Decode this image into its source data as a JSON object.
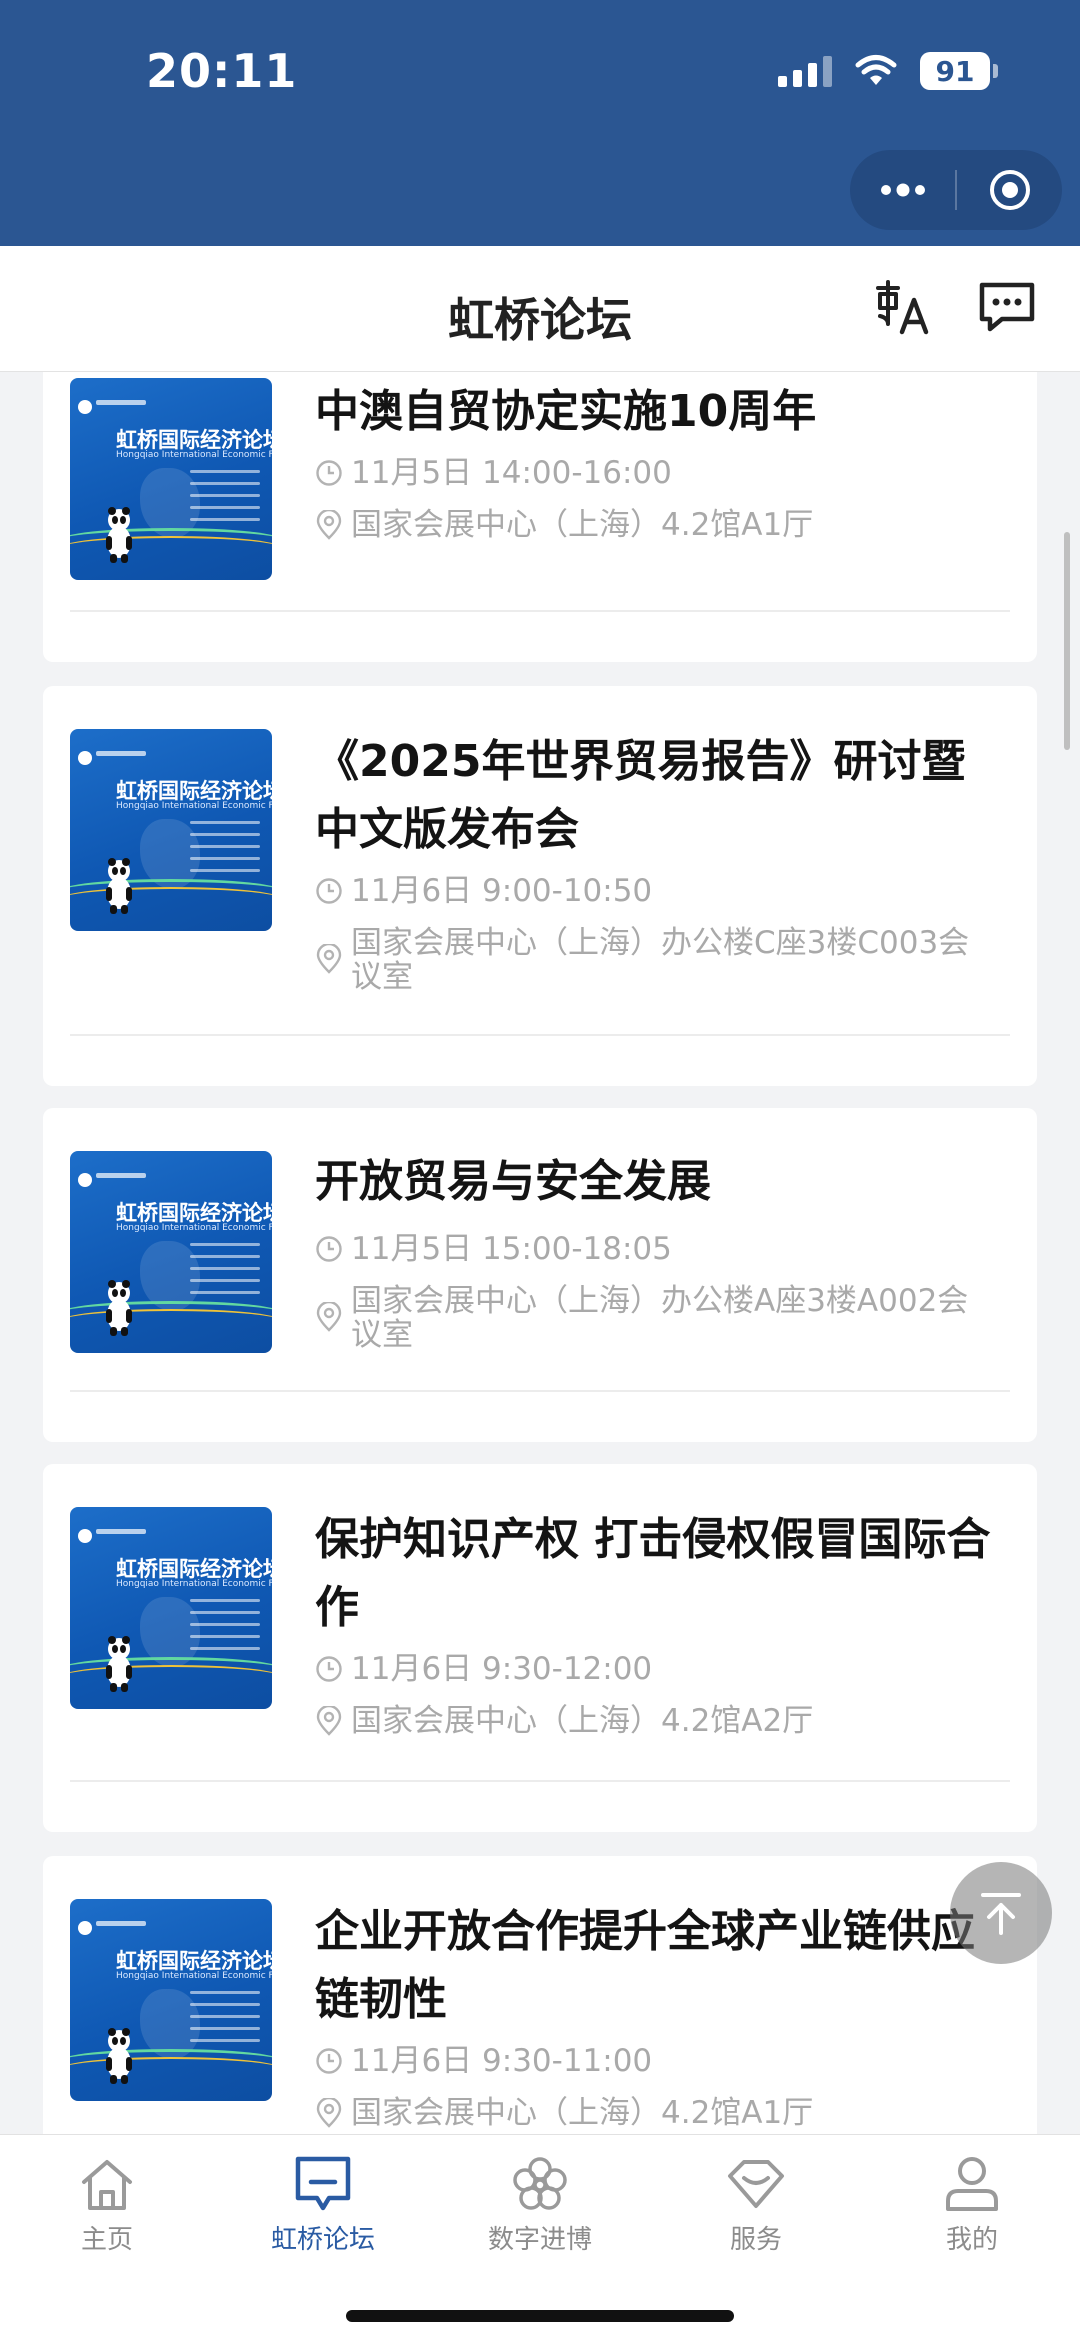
{
  "status_bar": {
    "time": "20:11",
    "battery": "91"
  },
  "header": {
    "title": "虹桥论坛"
  },
  "thumbnail": {
    "title": "虹桥国际经济论坛会",
    "subtitle": "Hongqiao International Economic Forum"
  },
  "events": [
    {
      "title": "中澳自贸协定实施10周年",
      "time": "11月5日 14:00-16:00",
      "location": "国家会展中心（上海）4.2馆A1厅"
    },
    {
      "title": "《2025年世界贸易报告》研讨暨中文版发布会",
      "time": "11月6日 9:00-10:50",
      "location": "国家会展中心（上海）办公楼C座3楼C003会议室"
    },
    {
      "title": "开放贸易与安全发展",
      "time": "11月5日 15:00-18:05",
      "location": "国家会展中心（上海）办公楼A座3楼A002会议室"
    },
    {
      "title": "保护知识产权 打击侵权假冒国际合作",
      "time": "11月6日 9:30-12:00",
      "location": "国家会展中心（上海）4.2馆A2厅"
    },
    {
      "title": "企业开放合作提升全球产业链供应链韧性",
      "time": "11月6日 9:30-11:00",
      "location": "国家会展中心（上海）4.2馆A1厅"
    }
  ],
  "tabs": [
    {
      "label": "主页",
      "icon": "home-icon"
    },
    {
      "label": "虹桥论坛",
      "icon": "forum-icon"
    },
    {
      "label": "数字进博",
      "icon": "flower-icon"
    },
    {
      "label": "服务",
      "icon": "service-icon"
    },
    {
      "label": "我的",
      "icon": "profile-icon"
    }
  ],
  "colors": {
    "brand": "#2b5692",
    "active_tab": "#2a5ba3",
    "meta_text": "#a9a9a9"
  }
}
